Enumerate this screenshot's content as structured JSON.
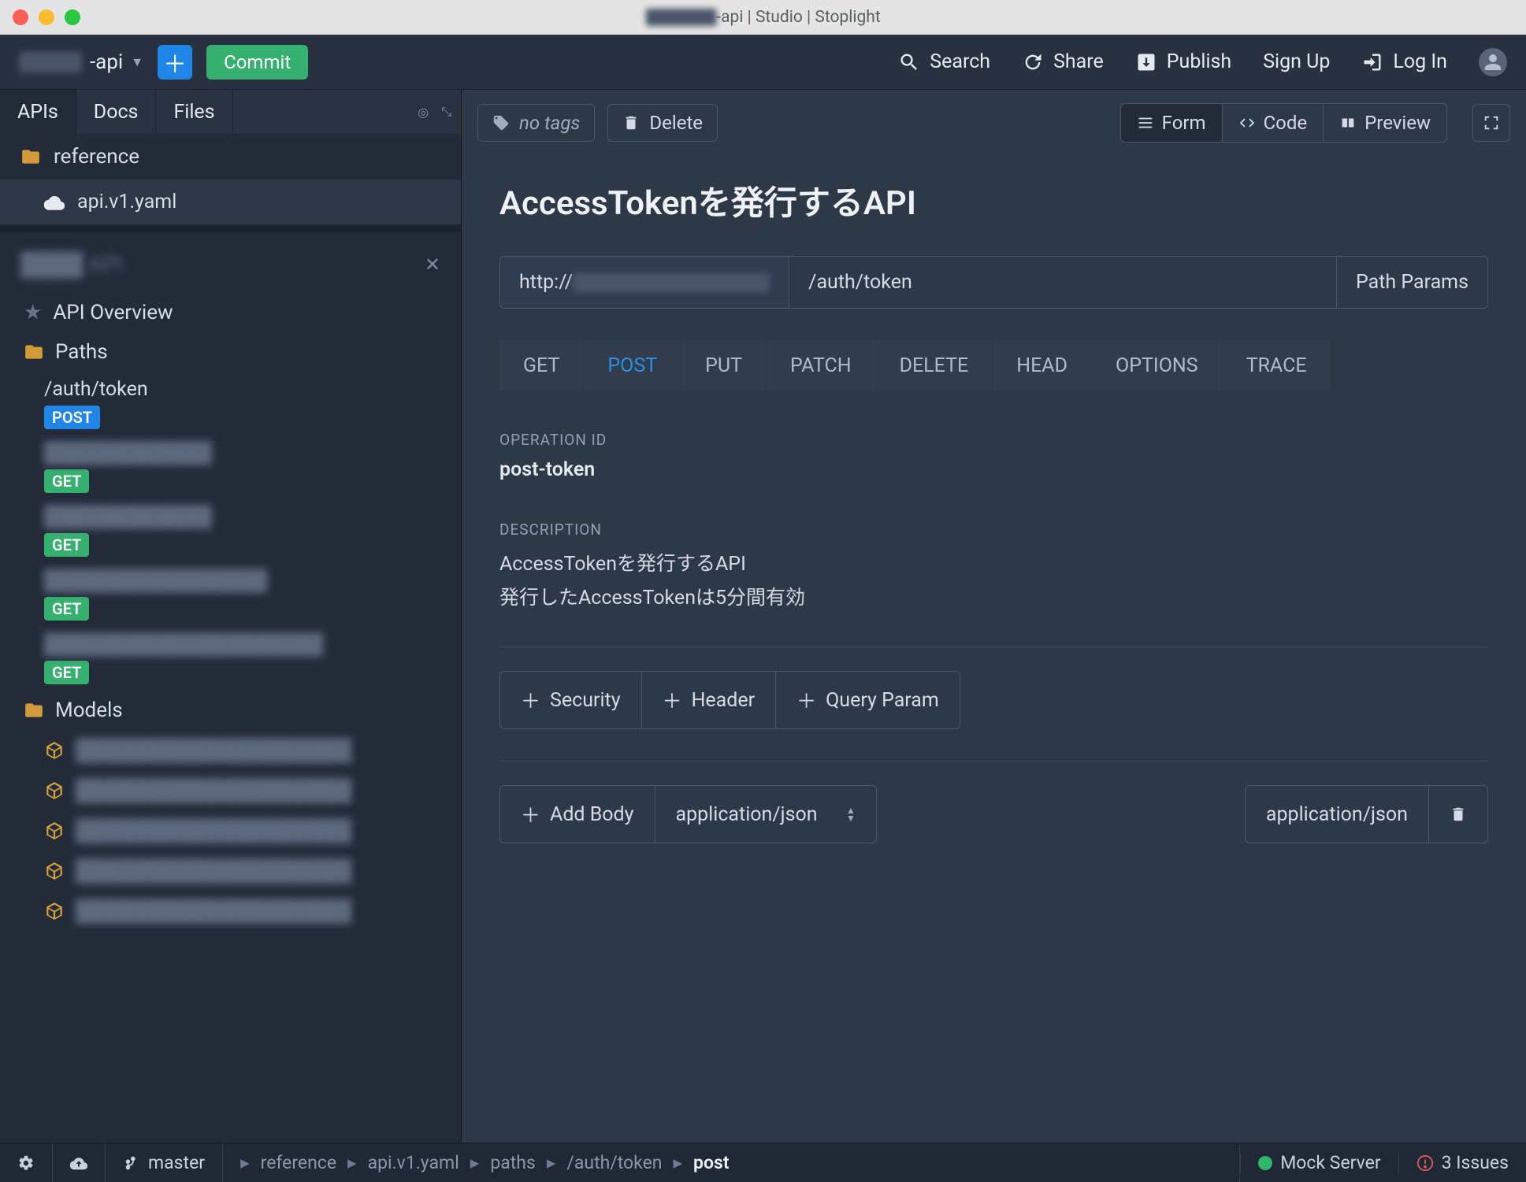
{
  "titlebar": {
    "title": "-api | Studio | Stoplight"
  },
  "header": {
    "project": "-api",
    "commit": "Commit",
    "actions": {
      "search": "Search",
      "share": "Share",
      "publish": "Publish",
      "signup": "Sign Up",
      "login": "Log In"
    }
  },
  "sidebar": {
    "tabs": {
      "apis": "APIs",
      "docs": "Docs",
      "files": "Files"
    },
    "reference": "reference",
    "file": "api.v1.yaml",
    "apiOverview": "API Overview",
    "paths_label": "Paths",
    "models_label": "Models",
    "paths": [
      {
        "name": "/auth/token",
        "method": "POST"
      },
      {
        "name": "████████████",
        "method": "GET"
      },
      {
        "name": "████████████",
        "method": "GET"
      },
      {
        "name": "████████████████",
        "method": "GET"
      },
      {
        "name": "████████████████████",
        "method": "GET"
      }
    ]
  },
  "content": {
    "no_tags": "no tags",
    "delete": "Delete",
    "views": {
      "form": "Form",
      "code": "Code",
      "preview": "Preview"
    },
    "title": "AccessTokenを発行するAPI",
    "host_prefix": "http://",
    "path": "/auth/token",
    "path_params": "Path Params",
    "methods": [
      "GET",
      "POST",
      "PUT",
      "PATCH",
      "DELETE",
      "HEAD",
      "OPTIONS",
      "TRACE"
    ],
    "active_method": "POST",
    "operation_id_label": "OPERATION ID",
    "operation_id": "post-token",
    "description_label": "DESCRIPTION",
    "description_line1": "AccessTokenを発行するAPI",
    "description_line2": "発行したAccessTokenは5分間有効",
    "chips": {
      "security": "Security",
      "header": "Header",
      "query": "Query Param"
    },
    "body": {
      "add": "Add Body",
      "mime": "application/json",
      "selected_mime": "application/json"
    }
  },
  "statusbar": {
    "branch": "master",
    "crumbs": [
      "reference",
      "api.v1.yaml",
      "paths",
      "/auth/token",
      "post"
    ],
    "mock": "Mock Server",
    "issues": "3 Issues"
  }
}
